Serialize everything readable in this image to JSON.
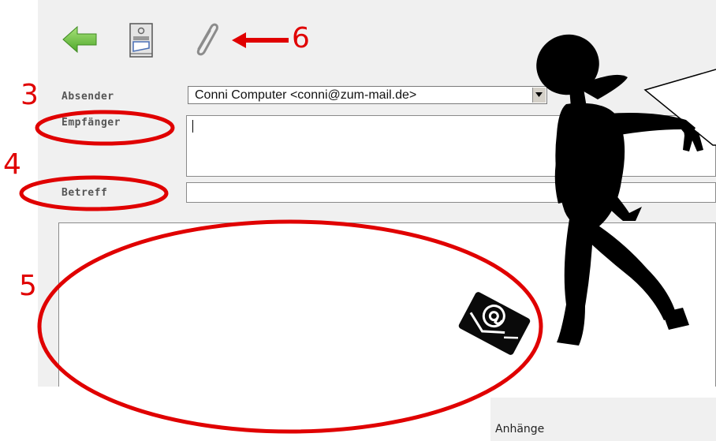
{
  "toolbar": {
    "back_icon": "back-arrow-icon",
    "fax_icon": "fax-icon",
    "attach_icon": "paperclip-icon"
  },
  "form": {
    "sender_label": "Absender",
    "sender_value": "Conni Computer <conni@zum-mail.de>",
    "recipient_label": "Empfänger",
    "recipient_value": "",
    "subject_label": "Betreff",
    "subject_value": "",
    "body_value": ""
  },
  "attachments": {
    "label": "Anhänge"
  },
  "annotations": {
    "n3": "3",
    "n4": "4",
    "n5": "5",
    "n6": "6",
    "color": "#e00000"
  }
}
